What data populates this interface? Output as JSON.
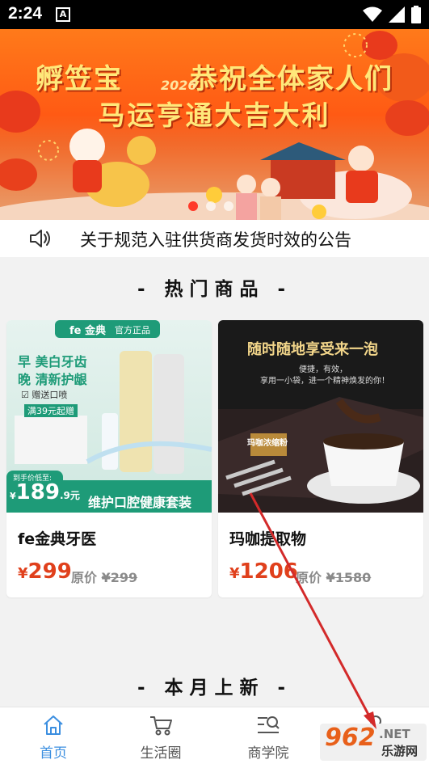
{
  "status_bar": {
    "time": "2:24",
    "notification_letter": "A"
  },
  "banner": {
    "line1_a": "孵笠宝",
    "line1_b": "恭祝全体家人们",
    "year": "2026",
    "line2": "马运亨通大吉大利",
    "slide_count": 3,
    "active_slide": 1
  },
  "notice": {
    "text": "关于规范入驻供货商发货时效的公告"
  },
  "hot": {
    "title": "- 热门商品 -"
  },
  "products": [
    {
      "name": "fe金典牙医",
      "price_currency": "¥",
      "price": "299",
      "original_label": "原价",
      "original_price": "¥299",
      "image": {
        "brand": "fe 金典",
        "tag": "官方正品",
        "lines": [
          "早 美白牙齿",
          "晚 清新护龈"
        ],
        "gift": "☑ 赠送口喷",
        "promo": "满39元起赠",
        "deal_label": "到手价低至:",
        "deal_price": "¥189.9元",
        "deal_big": "189",
        "deal_small": ".9元",
        "caption": "维护口腔健康套装"
      }
    },
    {
      "name": "玛咖提取物",
      "price_currency": "¥",
      "price": "1206",
      "original_label": "原价",
      "original_price": "¥1580",
      "image": {
        "headline": "随时随地享受来一泡",
        "subline1": "便捷，有效，",
        "subline2": "享用一小袋，进一个精神焕发的你！",
        "box_label": "玛咖浓缩粉"
      }
    }
  ],
  "new_this_month": {
    "title": "- 本月上新 -"
  },
  "tabs": [
    {
      "label": "首页",
      "icon": "home-icon",
      "active": true
    },
    {
      "label": "生活圈",
      "icon": "cart-icon",
      "active": false
    },
    {
      "label": "商学院",
      "icon": "list-search-icon",
      "active": false
    },
    {
      "label": "",
      "icon": "profile-icon",
      "active": false
    }
  ],
  "watermark": {
    "logo": "962",
    "net": ".NET",
    "site": "乐游网"
  },
  "colors": {
    "accent": "#3c8fe0",
    "price": "#e0401c",
    "arrow": "#d32a2a"
  }
}
